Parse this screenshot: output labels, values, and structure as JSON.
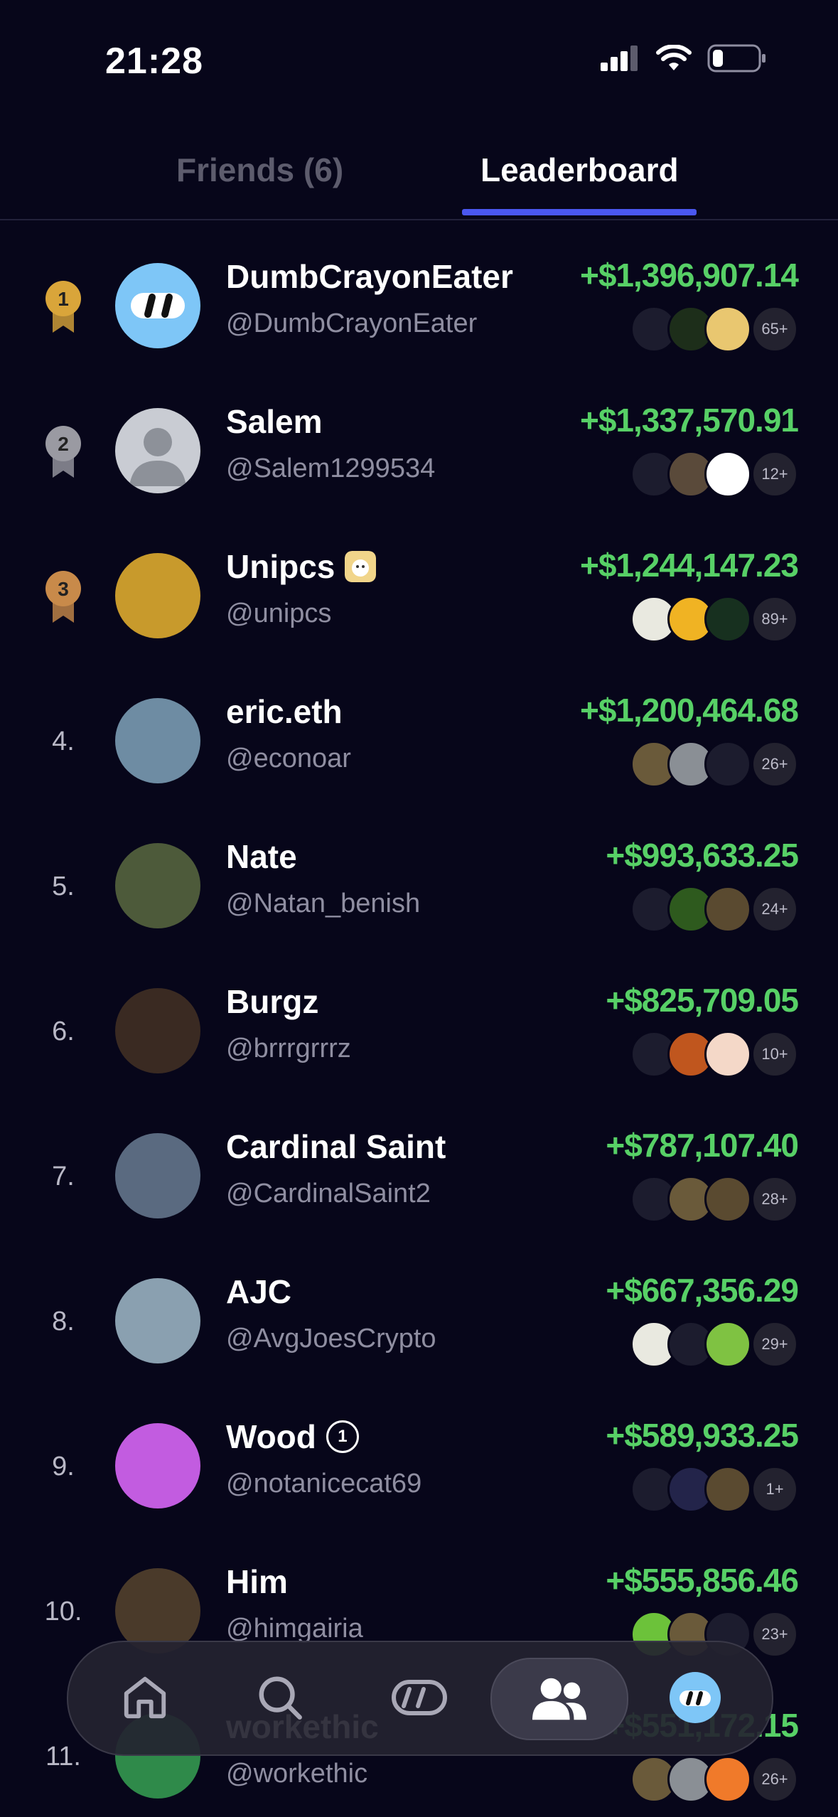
{
  "status_bar": {
    "time": "21:28"
  },
  "tabs": {
    "friends": "Friends (6)",
    "leaderboard": "Leaderboard"
  },
  "leaderboard": [
    {
      "rank": "1",
      "name": "DumbCrayonEater",
      "handle": "@DumbCrayonEater",
      "amount": "+$1,396,907.14",
      "more": "65+",
      "avatar_color": "#7ec6f7",
      "token_colors": [
        "#1c1c2e",
        "#1d2e1a",
        "#e9c770"
      ]
    },
    {
      "rank": "2",
      "name": "Salem",
      "handle": "@Salem1299534",
      "amount": "+$1,337,570.91",
      "more": "12+",
      "avatar_color": "#c9ccd3",
      "token_colors": [
        "#1c1c2e",
        "#5a4a3a",
        "#ffffff"
      ]
    },
    {
      "rank": "3",
      "name": "Unipcs",
      "handle": "@unipcs",
      "amount": "+$1,244,147.23",
      "more": "89+",
      "avatar_color": "#c89a2c",
      "token_colors": [
        "#e9e9e0",
        "#f0b323",
        "#17301f"
      ]
    },
    {
      "rank": "4.",
      "name": "eric.eth",
      "handle": "@econoar",
      "amount": "+$1,200,464.68",
      "more": "26+",
      "avatar_color": "#6e8ca3",
      "token_colors": [
        "#6a5a3a",
        "#8a8f95",
        "#1c1c2e"
      ]
    },
    {
      "rank": "5.",
      "name": "Nate",
      "handle": "@Natan_benish",
      "amount": "+$993,633.25",
      "more": "24+",
      "avatar_color": "#4d5a3a",
      "token_colors": [
        "#1c1c2e",
        "#2e5a1e",
        "#5a4a30"
      ]
    },
    {
      "rank": "6.",
      "name": "Burgz",
      "handle": "@brrrgrrrz",
      "amount": "+$825,709.05",
      "more": "10+",
      "avatar_color": "#3a2a22",
      "token_colors": [
        "#1c1c2e",
        "#c0561e",
        "#f4d8c8"
      ]
    },
    {
      "rank": "7.",
      "name": "Cardinal Saint",
      "handle": "@CardinalSaint2",
      "amount": "+$787,107.40",
      "more": "28+",
      "avatar_color": "#5a6a80",
      "token_colors": [
        "#1c1c2e",
        "#6a5a3a",
        "#5a4a30"
      ]
    },
    {
      "rank": "8.",
      "name": "AJC",
      "handle": "@AvgJoesCrypto",
      "amount": "+$667,356.29",
      "more": "29+",
      "avatar_color": "#8aa0b0",
      "token_colors": [
        "#e9e9e0",
        "#1c1c2e",
        "#7fc242"
      ]
    },
    {
      "rank": "9.",
      "name": "Wood",
      "handle": "@notanicecat69",
      "amount": "+$589,933.25",
      "more": "1+",
      "avatar_color": "#c25ce0",
      "token_colors": [
        "#1c1c2e",
        "#23244a",
        "#5a4a30"
      ]
    },
    {
      "rank": "10.",
      "name": "Him",
      "handle": "@himgairia",
      "amount": "+$555,856.46",
      "more": "23+",
      "avatar_color": "#4a3a2a",
      "token_colors": [
        "#6cc23a",
        "#6a5a3a",
        "#1c1c2e"
      ]
    },
    {
      "rank": "11.",
      "name": "workethic",
      "handle": "@workethic",
      "amount": "+$551,172.15",
      "more": "26+",
      "avatar_color": "#2f8a4a",
      "token_colors": [
        "#6a5a3a",
        "#8a8f95",
        "#f07a2a"
      ]
    }
  ],
  "wood_badge": "1",
  "bottom_nav": [
    "home-icon",
    "search-icon",
    "tokens-icon",
    "people-icon",
    "profile-avatar"
  ]
}
